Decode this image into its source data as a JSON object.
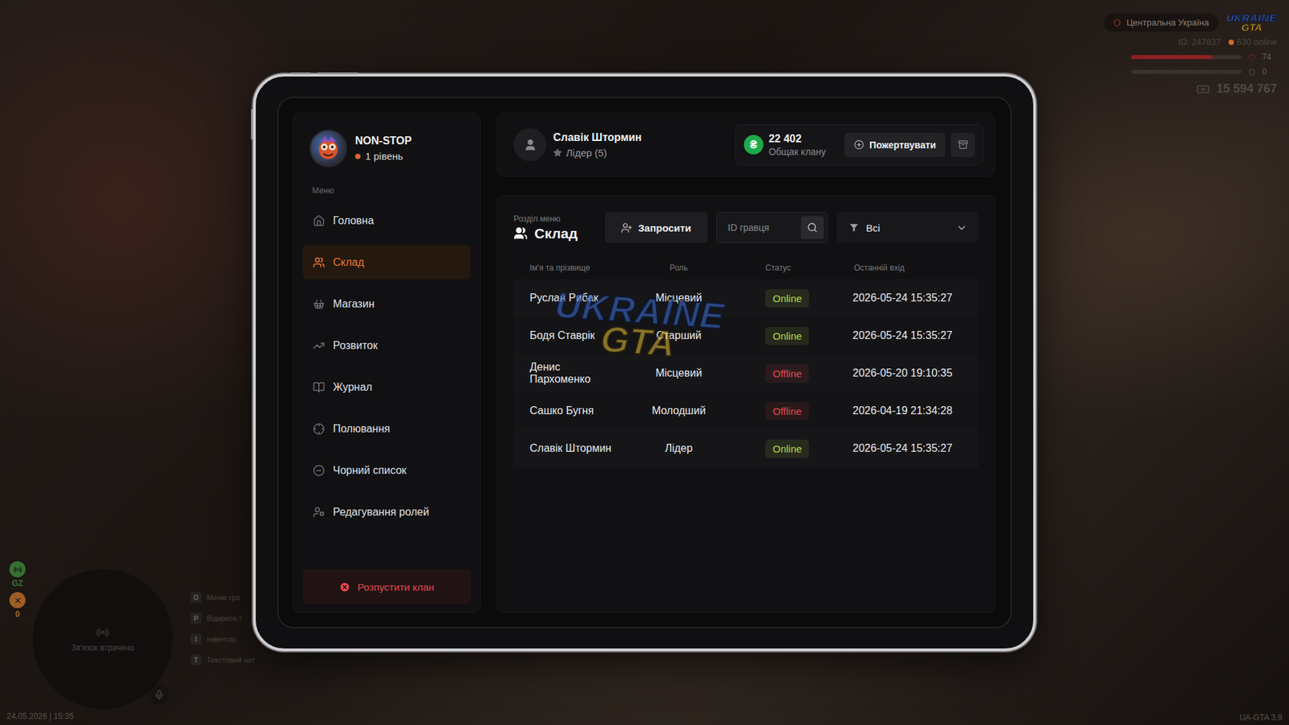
{
  "hud": {
    "region": "Центральна Україна",
    "logo": {
      "top": "UKRAINE",
      "bottom": "GTA"
    },
    "player_id": "ID: 247837",
    "online": "630 online",
    "health": {
      "level": 0.74,
      "reading": "74"
    },
    "armor": {
      "level": 0,
      "reading": "0"
    },
    "money": "15 594 767",
    "datetime": "24.05.2026 | 15:35",
    "version": "UA-GTA 3.9",
    "minimap": {
      "message": "Зв'язок втрачено"
    },
    "side_indicators": [
      {
        "label": "GZ",
        "color": "#3f8f3a"
      },
      {
        "label": "0",
        "color": "#c9762c"
      }
    ],
    "hints": [
      {
        "key": "O",
        "label": "Меню гра"
      },
      {
        "key": "P",
        "label": "Відкрити т"
      },
      {
        "key": "I",
        "label": "Інвентар"
      },
      {
        "key": "T",
        "label": "Текстовий чат"
      }
    ]
  },
  "clan": {
    "name": "NON-STOP",
    "level": "1 рівень"
  },
  "menu": {
    "title": "Меню",
    "items": [
      {
        "label": "Головна",
        "selected": false
      },
      {
        "label": "Склад",
        "selected": true
      },
      {
        "label": "Магазин",
        "selected": false
      },
      {
        "label": "Розвиток",
        "selected": false
      },
      {
        "label": "Журнал",
        "selected": false
      },
      {
        "label": "Полювання",
        "selected": false
      },
      {
        "label": "Чорний список",
        "selected": false
      },
      {
        "label": "Редагування ролей",
        "selected": false
      }
    ]
  },
  "disband_button": "Розпустити клан",
  "user": {
    "name": "Славік Штормин",
    "role": "Лідер (5)"
  },
  "treasury": {
    "currency": "₴",
    "amount": "22 402",
    "label": "Общак клану"
  },
  "donate_button": "Пожертвувати",
  "section": {
    "caption": "Розділ меню",
    "title": "Склад"
  },
  "invite_button": "Запросити",
  "search": {
    "placeholder": "ID гравця"
  },
  "filter": {
    "value": "Всі"
  },
  "table": {
    "columns": [
      "Ім'я та прізвище",
      "Роль",
      "Статус",
      "Останній вхід"
    ],
    "rows": [
      {
        "name": "Руслан Рибак",
        "role": "Місцевий",
        "status": "Online",
        "online": true,
        "color": "#b5dc45",
        "last_login": "2026-05-24 15:35:27"
      },
      {
        "name": "Бодя Ставрік",
        "role": "Старший",
        "status": "Online",
        "online": true,
        "color": "#b5dc45",
        "last_login": "2026-05-24 15:35:27"
      },
      {
        "name": "Денис Пархоменко",
        "role": "Місцевий",
        "status": "Offline",
        "online": false,
        "color": "#e5484d",
        "last_login": "2026-05-20 19:10:35"
      },
      {
        "name": "Сашко Бугня",
        "role": "Молодший",
        "status": "Offline",
        "online": false,
        "color": "#e5484d",
        "last_login": "2026-04-19 21:34:28"
      },
      {
        "name": "Славік Штормин",
        "role": "Лідер",
        "status": "Online",
        "online": true,
        "color": "#b5dc45",
        "last_login": "2026-05-24 15:35:27"
      }
    ]
  },
  "watermark": {
    "top": "UKRAINE",
    "bottom": "GTA"
  }
}
